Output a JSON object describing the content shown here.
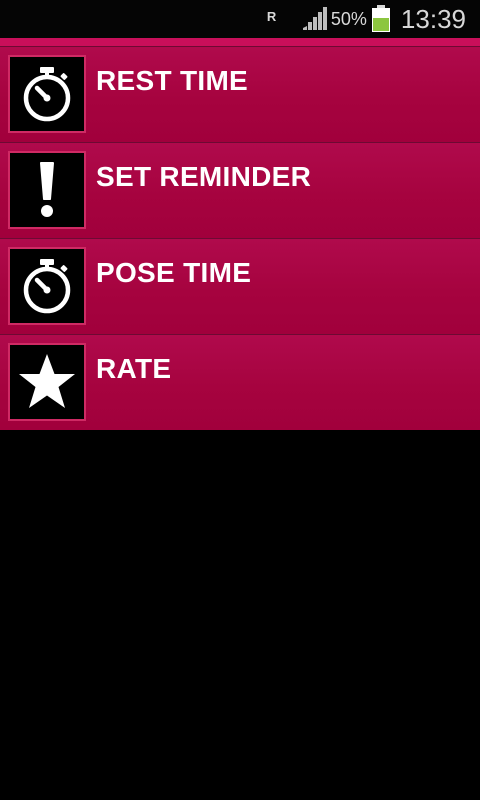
{
  "status_bar": {
    "roaming": "R",
    "battery_percent": "50%",
    "time": "13:39",
    "signal_icon": "signal-strength-icon",
    "battery_icon": "battery-charging-icon",
    "battery_color": "#8cc63f"
  },
  "theme": {
    "accent": "#c90f5a",
    "item_background": "#a6033f",
    "icon_border": "#cf2a64",
    "background": "#000000"
  },
  "menu": {
    "items": [
      {
        "label": "REST TIME",
        "icon": "stopwatch-icon"
      },
      {
        "label": "SET REMINDER",
        "icon": "exclamation-icon"
      },
      {
        "label": "POSE TIME",
        "icon": "stopwatch-icon"
      },
      {
        "label": "RATE",
        "icon": "star-icon"
      }
    ]
  }
}
